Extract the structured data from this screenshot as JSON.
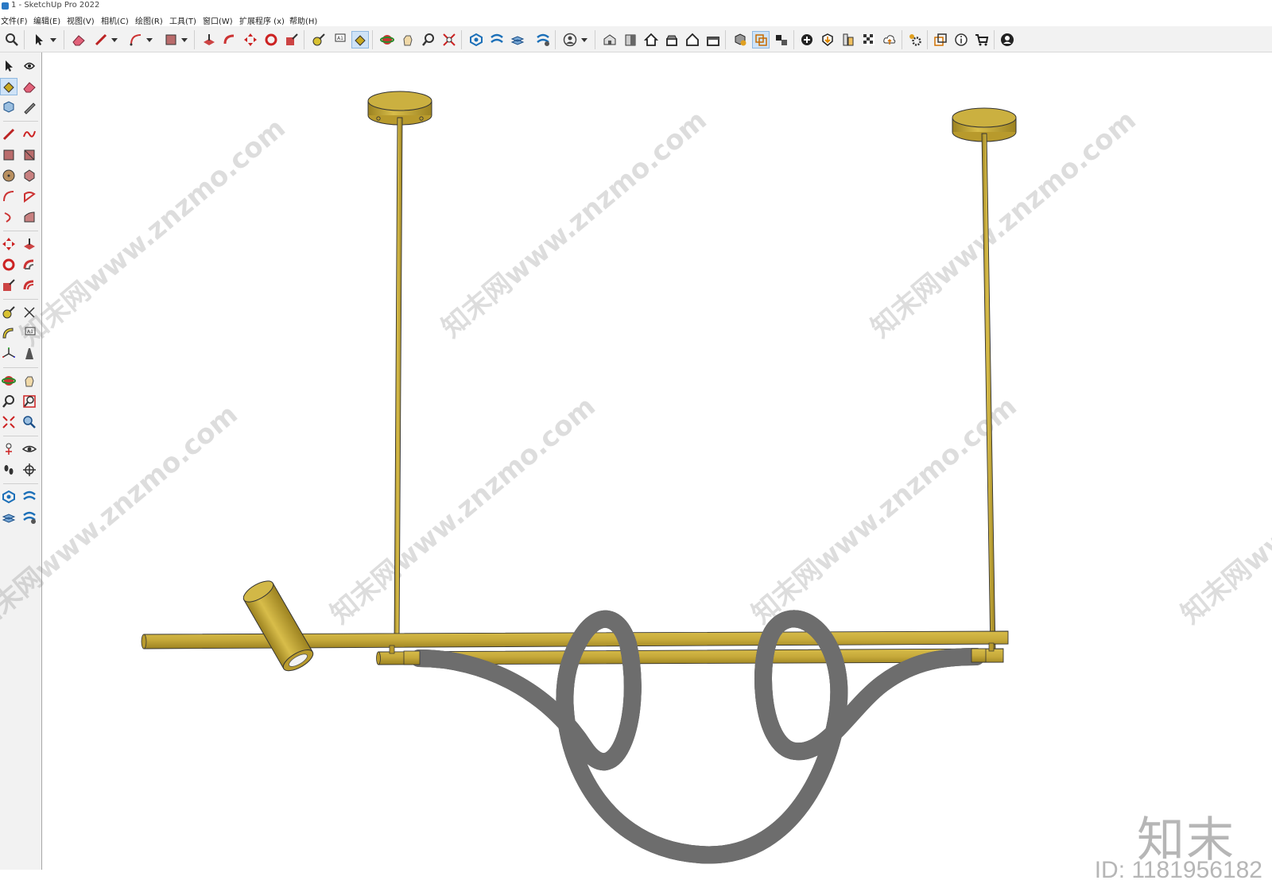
{
  "window": {
    "title": "1 - SketchUp Pro 2022"
  },
  "menu": [
    {
      "label": "文件(F)"
    },
    {
      "label": "编辑(E)"
    },
    {
      "label": "视图(V)"
    },
    {
      "label": "相机(C)"
    },
    {
      "label": "绘图(R)"
    },
    {
      "label": "工具(T)"
    },
    {
      "label": "窗口(W)"
    },
    {
      "label": "扩展程序 (x)"
    },
    {
      "label": "帮助(H)"
    }
  ],
  "toolbar_icons": [
    "search-icon",
    "select-icon",
    "dropdown-icon",
    "eraser-icon",
    "pencil-icon",
    "arc-icon",
    "rectangle-icon",
    "push-pull-icon",
    "follow-me-icon",
    "move-icon",
    "rotate-icon",
    "scale-icon",
    "tape-measure-icon",
    "text-icon",
    "paint-bucket-icon",
    "orbit-icon",
    "pan-icon",
    "zoom-icon",
    "zoom-extents-icon",
    "warehouse-icon",
    "extension-warehouse-icon",
    "layout-icon",
    "style-icon",
    "user-icon",
    "iso-view-icon",
    "front-view-icon",
    "home-view-icon",
    "top-view-icon",
    "right-view-icon",
    "back-view-icon",
    "component-icon",
    "section-plane-icon",
    "section-display-icon",
    "add-location-icon",
    "sandbox-icon",
    "photo-texture-icon",
    "shadow-icon",
    "cloud-icon",
    "settings-icon",
    "outliner-icon",
    "info-icon",
    "cart-icon",
    "account-icon"
  ],
  "left_icons": [
    "select-icon",
    "orbit-icon",
    "paint-bucket-icon",
    "eraser-icon",
    "component-icon",
    "tape-icon",
    "pencil-icon",
    "freehand-icon",
    "rectangle-icon",
    "rotated-rect-icon",
    "circle-icon",
    "polygon-icon",
    "arc-icon",
    "pie-icon",
    "two-point-arc-icon",
    "three-point-arc-icon",
    "move-icon",
    "push-pull-icon",
    "rotate-icon",
    "follow-me-icon",
    "scale-icon",
    "offset-icon",
    "tape-measure-icon",
    "dimension-icon",
    "protractor-icon",
    "text-icon",
    "axes-icon",
    "3d-text-icon",
    "orbit-tool-icon",
    "pan-tool-icon",
    "zoom-tool-icon",
    "zoom-window-icon",
    "zoom-extents-tool-icon",
    "previous-view-icon",
    "position-camera-icon",
    "look-around-icon",
    "walk-icon",
    "section-plane-tool-icon",
    "warehouse-tool-icon",
    "extension-tool-icon",
    "layers-tool-icon",
    "sandbox-tool-icon"
  ],
  "viewport": {
    "model_description": "pendant light model"
  },
  "watermark": {
    "site": "知末网www.znzmo.com",
    "logo": "知末",
    "id": "ID: 1181956182"
  },
  "colors": {
    "brass": "#c6a93a",
    "brass_dark": "#9c8220",
    "tube": "#f1f1f1",
    "tube_edge": "#7a7a7a",
    "toolbar_bg": "#f2f2f2"
  }
}
